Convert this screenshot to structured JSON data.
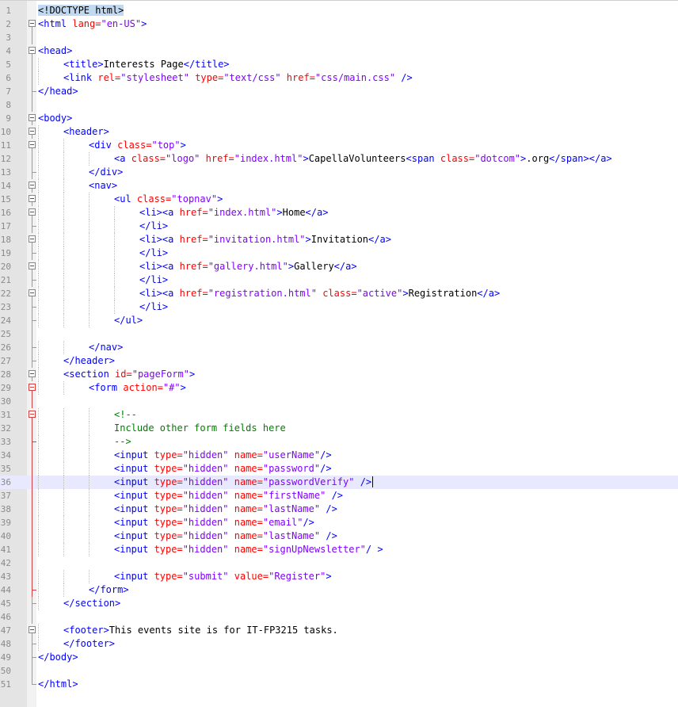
{
  "editor": {
    "current_line": 36,
    "lines": [
      {
        "n": "1",
        "indent": 0,
        "fold": "none",
        "tokens": [
          [
            "doc",
            "<!DOCTYPE html>"
          ]
        ]
      },
      {
        "n": "2",
        "indent": 0,
        "fold": "open",
        "tokens": [
          [
            "tag",
            "<html "
          ],
          [
            "attr",
            "lang="
          ],
          [
            "val",
            "\"en-US\""
          ],
          [
            "tag",
            ">"
          ]
        ]
      },
      {
        "n": "3",
        "indent": 0,
        "fold": "line",
        "tokens": []
      },
      {
        "n": "4",
        "indent": 0,
        "fold": "open",
        "tokens": [
          [
            "tag",
            "<head>"
          ]
        ]
      },
      {
        "n": "5",
        "indent": 1,
        "fold": "line",
        "tokens": [
          [
            "tag",
            "<title>"
          ],
          [
            "txt",
            "Interests Page"
          ],
          [
            "tag",
            "</title>"
          ]
        ]
      },
      {
        "n": "6",
        "indent": 1,
        "fold": "line",
        "tokens": [
          [
            "tag",
            "<link "
          ],
          [
            "attr",
            "rel="
          ],
          [
            "val",
            "\"stylesheet\" "
          ],
          [
            "attr",
            "type="
          ],
          [
            "val",
            "\"text/css\" "
          ],
          [
            "attr",
            "href="
          ],
          [
            "val",
            "\"css/main.css\" "
          ],
          [
            "tag",
            "/>"
          ]
        ]
      },
      {
        "n": "7",
        "indent": 0,
        "fold": "end",
        "tokens": [
          [
            "tag",
            "</head>"
          ]
        ]
      },
      {
        "n": "8",
        "indent": 0,
        "fold": "line",
        "tokens": []
      },
      {
        "n": "9",
        "indent": 0,
        "fold": "open",
        "tokens": [
          [
            "tag",
            "<body>"
          ]
        ]
      },
      {
        "n": "10",
        "indent": 1,
        "fold": "open",
        "tokens": [
          [
            "tag",
            "<header>"
          ]
        ]
      },
      {
        "n": "11",
        "indent": 2,
        "fold": "open",
        "tokens": [
          [
            "tag",
            "<div "
          ],
          [
            "attr",
            "class="
          ],
          [
            "val",
            "\"top\""
          ],
          [
            "tag",
            ">"
          ]
        ]
      },
      {
        "n": "12",
        "indent": 3,
        "fold": "line",
        "tokens": [
          [
            "tag",
            "<a "
          ],
          [
            "attr",
            "class="
          ],
          [
            "val",
            "\"logo\" "
          ],
          [
            "attr",
            "href="
          ],
          [
            "val",
            "\"index.html\""
          ],
          [
            "tag",
            ">"
          ],
          [
            "txt",
            "CapellaVolunteers"
          ],
          [
            "tag",
            "<span "
          ],
          [
            "attr",
            "class="
          ],
          [
            "val",
            "\"dotcom\""
          ],
          [
            "tag",
            ">"
          ],
          [
            "txt",
            ".org"
          ],
          [
            "tag",
            "</span></a>"
          ]
        ]
      },
      {
        "n": "13",
        "indent": 2,
        "fold": "end",
        "tokens": [
          [
            "tag",
            "</div>"
          ]
        ]
      },
      {
        "n": "14",
        "indent": 2,
        "fold": "open",
        "tokens": [
          [
            "tag",
            "<nav>"
          ]
        ]
      },
      {
        "n": "15",
        "indent": 3,
        "fold": "open",
        "tokens": [
          [
            "tag",
            "<ul "
          ],
          [
            "attr",
            "class="
          ],
          [
            "val",
            "\"topnav\""
          ],
          [
            "tag",
            ">"
          ]
        ]
      },
      {
        "n": "16",
        "indent": 4,
        "fold": "open",
        "tokens": [
          [
            "tag",
            "<li><a "
          ],
          [
            "attr",
            "href="
          ],
          [
            "val",
            "\"index.html\""
          ],
          [
            "tag",
            ">"
          ],
          [
            "txt",
            "Home"
          ],
          [
            "tag",
            "</a>"
          ]
        ]
      },
      {
        "n": "17",
        "indent": 4,
        "fold": "end",
        "tokens": [
          [
            "tag",
            "</li>"
          ]
        ]
      },
      {
        "n": "18",
        "indent": 4,
        "fold": "open",
        "tokens": [
          [
            "tag",
            "<li><a "
          ],
          [
            "attr",
            "href="
          ],
          [
            "val",
            "\"invitation.html\""
          ],
          [
            "tag",
            ">"
          ],
          [
            "txt",
            "Invitation"
          ],
          [
            "tag",
            "</a>"
          ]
        ]
      },
      {
        "n": "19",
        "indent": 4,
        "fold": "end",
        "tokens": [
          [
            "tag",
            "</li>"
          ]
        ]
      },
      {
        "n": "20",
        "indent": 4,
        "fold": "open",
        "tokens": [
          [
            "tag",
            "<li><a "
          ],
          [
            "attr",
            "href="
          ],
          [
            "val",
            "\"gallery.html\""
          ],
          [
            "tag",
            ">"
          ],
          [
            "txt",
            "Gallery"
          ],
          [
            "tag",
            "</a>"
          ]
        ]
      },
      {
        "n": "21",
        "indent": 4,
        "fold": "end",
        "tokens": [
          [
            "tag",
            "</li>"
          ]
        ]
      },
      {
        "n": "22",
        "indent": 4,
        "fold": "open",
        "tokens": [
          [
            "tag",
            "<li><a "
          ],
          [
            "attr",
            "href="
          ],
          [
            "val",
            "\"registration.html\" "
          ],
          [
            "attr",
            "class="
          ],
          [
            "val",
            "\"active\""
          ],
          [
            "tag",
            ">"
          ],
          [
            "txt",
            "Registration"
          ],
          [
            "tag",
            "</a>"
          ]
        ]
      },
      {
        "n": "23",
        "indent": 4,
        "fold": "end",
        "tokens": [
          [
            "tag",
            "</li>"
          ]
        ]
      },
      {
        "n": "24",
        "indent": 3,
        "fold": "end",
        "tokens": [
          [
            "tag",
            "</ul>"
          ]
        ]
      },
      {
        "n": "25",
        "indent": 0,
        "fold": "line",
        "tokens": []
      },
      {
        "n": "26",
        "indent": 2,
        "fold": "end",
        "tokens": [
          [
            "tag",
            "</nav>"
          ]
        ]
      },
      {
        "n": "27",
        "indent": 1,
        "fold": "end",
        "tokens": [
          [
            "tag",
            "</header>"
          ]
        ]
      },
      {
        "n": "28",
        "indent": 1,
        "fold": "open",
        "tokens": [
          [
            "tag",
            "<section "
          ],
          [
            "attr",
            "id="
          ],
          [
            "val",
            "\"pageForm\""
          ],
          [
            "tag",
            ">"
          ]
        ]
      },
      {
        "n": "29",
        "indent": 2,
        "fold": "open-red",
        "tokens": [
          [
            "tag",
            "<form "
          ],
          [
            "attr",
            "action="
          ],
          [
            "val",
            "\"#\""
          ],
          [
            "tag",
            ">"
          ]
        ]
      },
      {
        "n": "30",
        "indent": 0,
        "fold": "line-red",
        "tokens": []
      },
      {
        "n": "31",
        "indent": 3,
        "fold": "open-red",
        "tokens": [
          [
            "com",
            "<!--"
          ]
        ]
      },
      {
        "n": "32",
        "indent": 3,
        "fold": "line-red",
        "tokens": [
          [
            "com",
            "Include other form fields here"
          ]
        ]
      },
      {
        "n": "33",
        "indent": 3,
        "fold": "end-red",
        "tokens": [
          [
            "com",
            "-->"
          ]
        ]
      },
      {
        "n": "34",
        "indent": 3,
        "fold": "line-red",
        "tokens": [
          [
            "tag",
            "<input "
          ],
          [
            "attr",
            "type="
          ],
          [
            "val",
            "\"hidden\" "
          ],
          [
            "attr",
            "name="
          ],
          [
            "val",
            "\"userName\""
          ],
          [
            "tag",
            "/>"
          ]
        ]
      },
      {
        "n": "35",
        "indent": 3,
        "fold": "line-red",
        "tokens": [
          [
            "tag",
            "<input "
          ],
          [
            "attr",
            "type="
          ],
          [
            "val",
            "\"hidden\" "
          ],
          [
            "attr",
            "name="
          ],
          [
            "val",
            "\"password\""
          ],
          [
            "tag",
            "/>"
          ]
        ]
      },
      {
        "n": "36",
        "indent": 3,
        "fold": "line-red",
        "tokens": [
          [
            "tag",
            "<input "
          ],
          [
            "attr",
            "type="
          ],
          [
            "val",
            "\"hidden\" "
          ],
          [
            "attr",
            "name="
          ],
          [
            "val",
            "\"passwordVerify\" "
          ],
          [
            "tag",
            "/>"
          ]
        ]
      },
      {
        "n": "37",
        "indent": 3,
        "fold": "line-red",
        "tokens": [
          [
            "tag",
            "<input "
          ],
          [
            "attr",
            "type="
          ],
          [
            "val",
            "\"hidden\" "
          ],
          [
            "attr",
            "name="
          ],
          [
            "val",
            "\"firstName\" "
          ],
          [
            "tag",
            "/>"
          ]
        ]
      },
      {
        "n": "38",
        "indent": 3,
        "fold": "line-red",
        "tokens": [
          [
            "tag",
            "<input "
          ],
          [
            "attr",
            "type="
          ],
          [
            "val",
            "\"hidden\" "
          ],
          [
            "attr",
            "name="
          ],
          [
            "val",
            "\"lastName\" "
          ],
          [
            "tag",
            "/>"
          ]
        ]
      },
      {
        "n": "39",
        "indent": 3,
        "fold": "line-red",
        "tokens": [
          [
            "tag",
            "<input "
          ],
          [
            "attr",
            "type="
          ],
          [
            "val",
            "\"hidden\" "
          ],
          [
            "attr",
            "name="
          ],
          [
            "val",
            "\"email\""
          ],
          [
            "tag",
            "/>"
          ]
        ]
      },
      {
        "n": "40",
        "indent": 3,
        "fold": "line-red",
        "tokens": [
          [
            "tag",
            "<input "
          ],
          [
            "attr",
            "type="
          ],
          [
            "val",
            "\"hidden\" "
          ],
          [
            "attr",
            "name="
          ],
          [
            "val",
            "\"lastName\" "
          ],
          [
            "tag",
            "/>"
          ]
        ]
      },
      {
        "n": "41",
        "indent": 3,
        "fold": "line-red",
        "tokens": [
          [
            "tag",
            "<input "
          ],
          [
            "attr",
            "type="
          ],
          [
            "val",
            "\"hidden\" "
          ],
          [
            "attr",
            "name="
          ],
          [
            "val",
            "\"signUpNewsletter\""
          ],
          [
            "tag",
            "/ >"
          ]
        ]
      },
      {
        "n": "42",
        "indent": 0,
        "fold": "line-red",
        "tokens": []
      },
      {
        "n": "43",
        "indent": 3,
        "fold": "line-red",
        "tokens": [
          [
            "tag",
            "<input "
          ],
          [
            "attr",
            "type="
          ],
          [
            "val",
            "\"submit\" "
          ],
          [
            "attr",
            "value="
          ],
          [
            "val",
            "\"Register\""
          ],
          [
            "tag",
            ">"
          ]
        ]
      },
      {
        "n": "44",
        "indent": 2,
        "fold": "end-red",
        "tokens": [
          [
            "tag",
            "</form>"
          ]
        ]
      },
      {
        "n": "45",
        "indent": 1,
        "fold": "end",
        "tokens": [
          [
            "tag",
            "</section>"
          ]
        ]
      },
      {
        "n": "46",
        "indent": 0,
        "fold": "line",
        "tokens": []
      },
      {
        "n": "47",
        "indent": 1,
        "fold": "open",
        "tokens": [
          [
            "tag",
            "<footer>"
          ],
          [
            "txt",
            "This events site is for IT-FP3215 tasks."
          ]
        ]
      },
      {
        "n": "48",
        "indent": 1,
        "fold": "end",
        "tokens": [
          [
            "tag",
            "</footer>"
          ]
        ]
      },
      {
        "n": "49",
        "indent": 0,
        "fold": "end",
        "tokens": [
          [
            "tag",
            "</body>"
          ]
        ]
      },
      {
        "n": "50",
        "indent": 0,
        "fold": "line",
        "tokens": []
      },
      {
        "n": "51",
        "indent": 0,
        "fold": "end",
        "tokens": [
          [
            "tag",
            "</html>"
          ]
        ]
      }
    ]
  }
}
